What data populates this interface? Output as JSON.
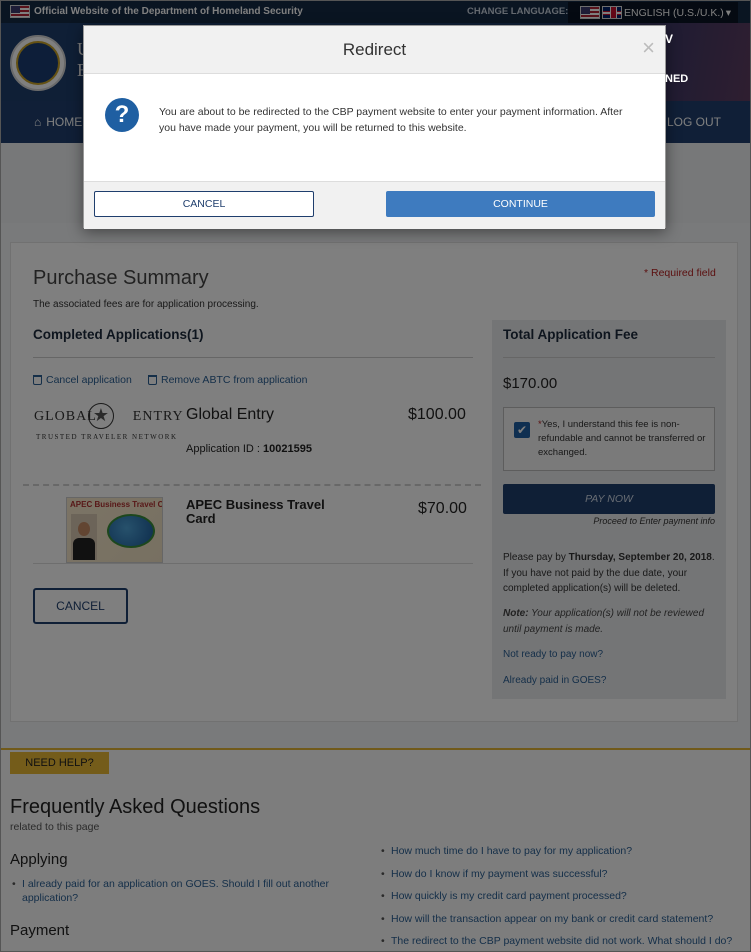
{
  "topbar": {
    "official_text": "Official Website of the Department of Homeland Security",
    "change_language_label": "CHANGE LANGUAGE:",
    "language_value": "ENGLISH (U.S./U.K.)",
    "language_caret": "▾"
  },
  "header": {
    "partial_title": "U",
    "partial_title2": "E",
    "right_fragment_1": "V",
    "right_fragment_2": "NED"
  },
  "nav": {
    "home_label": "HOME",
    "logout_label": "LOG OUT"
  },
  "summary": {
    "title": "Purchase Summary",
    "required_note": "* Required field",
    "assoc_text": "The associated fees are for application processing.",
    "completed_heading": "Completed Applications(1)",
    "cancel_application_link": "Cancel application",
    "remove_abtc_link": "Remove ABTC from application",
    "cancel_button": "CANCEL"
  },
  "applications": [
    {
      "logo_line1": "GLOBAL",
      "logo_line1b": "ENTRY",
      "logo_line2": "TRUSTED TRAVELER NETWORK",
      "name": "Global Entry",
      "price": "$100.00",
      "app_id_label": "Application ID : ",
      "app_id": "10021595"
    },
    {
      "card_header": "APEC Business Travel Card",
      "name": "APEC Business Travel Card",
      "price": "$70.00"
    }
  ],
  "fee_panel": {
    "title": "Total Application Fee",
    "amount": "$170.00",
    "ack_star": "*",
    "ack_text": "Yes, I understand this fee is non-refundable and cannot be transferred or exchanged.",
    "ack_checked": true,
    "pay_now": "PAY NOW",
    "proceed_text": "Proceed to Enter payment info",
    "due_prefix": "Please pay by ",
    "due_date": "Thursday, September 20, 2018",
    "due_suffix": ". If you have not paid by the due date, your completed application(s) will be deleted.",
    "note_label": "Note:",
    "note_text": " Your application(s) will not be reviewed until payment is made.",
    "not_ready_link": "Not ready to pay now?",
    "already_paid_link": "Already paid in GOES?"
  },
  "help": {
    "badge": "NEED HELP?",
    "faq_title": "Frequently Asked Questions",
    "faq_sub": "related to this page",
    "applying_heading": "Applying",
    "payment_heading": "Payment",
    "applying_items": [
      "I already paid for an application on GOES. Should I fill out another application?"
    ],
    "right_items": [
      "How much time do I have to pay for my application?",
      "How do I know if my payment was successful?",
      "How quickly is my credit card payment processed?",
      "How will the transaction appear on my bank or credit card statement?",
      "The redirect to the CBP payment website did not work. What should I do?"
    ]
  },
  "modal": {
    "title": "Redirect",
    "close": "×",
    "icon_glyph": "?",
    "message": "You are about to be redirected to the CBP payment website to enter your payment information. After you have made your payment, you will be returned to this website.",
    "cancel_label": "CANCEL",
    "continue_label": "CONTINUE"
  }
}
